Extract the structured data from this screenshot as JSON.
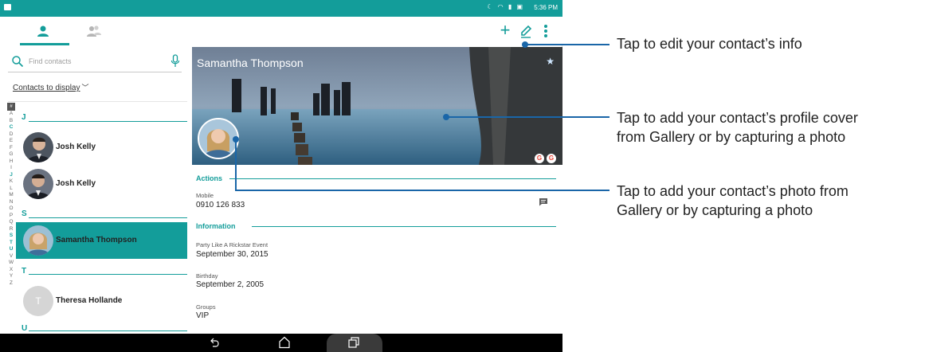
{
  "status_bar": {
    "time": "5:36 PM",
    "icons": [
      "moon-icon",
      "wifi-icon",
      "signal-icon",
      "battery-charging-icon"
    ]
  },
  "toolbar": {
    "tabs": [
      "contacts-tab",
      "groups-tab"
    ],
    "actions": [
      "add-icon",
      "edit-icon",
      "more-icon"
    ],
    "accent_color": "#139d9a"
  },
  "left_pane": {
    "search_placeholder": "Find contacts",
    "display_filter": "Contacts to display",
    "alphabet_hash": "#",
    "alphabet": [
      "A",
      "B",
      "C",
      "D",
      "E",
      "F",
      "G",
      "H",
      "I",
      "J",
      "K",
      "L",
      "M",
      "N",
      "O",
      "P",
      "Q",
      "R",
      "S",
      "T",
      "U",
      "V",
      "W",
      "X",
      "Y",
      "Z"
    ],
    "sections": [
      {
        "letter": "J",
        "contacts": [
          "Josh Kelly",
          "Josh Kelly"
        ]
      },
      {
        "letter": "S",
        "contacts": [
          "Samantha Thompson"
        ]
      },
      {
        "letter": "T",
        "contacts": [
          "Theresa Hollande"
        ]
      },
      {
        "letter": "U",
        "contacts": []
      }
    ],
    "placeholder_avatar_letter": "T",
    "selected_contact": "Samantha Thompson"
  },
  "detail": {
    "name": "Samantha Thompson",
    "actions_header": "Actions",
    "mobile_label": "Mobile",
    "mobile_value": "0910 126 833",
    "information_header": "Information",
    "fields": [
      {
        "label": "Party Like A Rickstar Event",
        "value": "September 30, 2015"
      },
      {
        "label": "Birthday",
        "value": "September 2, 2005"
      },
      {
        "label": "Groups",
        "value": "VIP"
      }
    ],
    "google_badge": "G"
  },
  "callouts": [
    {
      "text_lines": [
        "Tap to edit your contact’s info"
      ]
    },
    {
      "text_lines": [
        "Tap to add your contact’s profile cover",
        "from Gallery or by capturing a photo"
      ]
    },
    {
      "text_lines": [
        "Tap to add your contact’s photo from",
        "Gallery or by capturing a photo"
      ]
    }
  ]
}
